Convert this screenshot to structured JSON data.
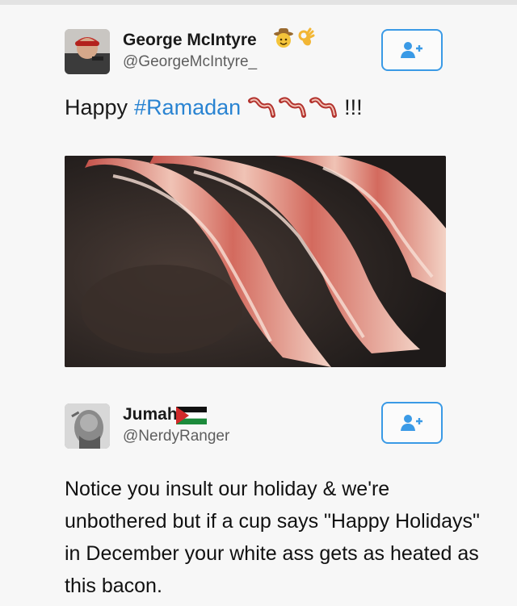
{
  "tweet1": {
    "author": {
      "name": "George McIntyre",
      "handle": "@GeorgeMcIntyre_",
      "name_emojis": [
        "cowboy-emoji",
        "ok-hand-emoji"
      ]
    },
    "text": {
      "prefix": "Happy",
      "hashtag": "#Ramadan",
      "bacon_emoji_count": 3,
      "suffix": "!!!"
    },
    "image": {
      "subject": "bacon strips frying in a pan"
    }
  },
  "tweet2": {
    "author": {
      "name": "Jumah",
      "handle": "@NerdyRanger",
      "flag": "palestine-flag-emoji"
    },
    "text": "Notice you insult our holiday & we're unbothered but if a cup says \"Happy Holidays\" in December your white ass gets as heated as this bacon."
  },
  "colors": {
    "hashtag": "#2a84d2",
    "follow_border": "#3a9ae6",
    "handle": "#5e5e5e"
  }
}
